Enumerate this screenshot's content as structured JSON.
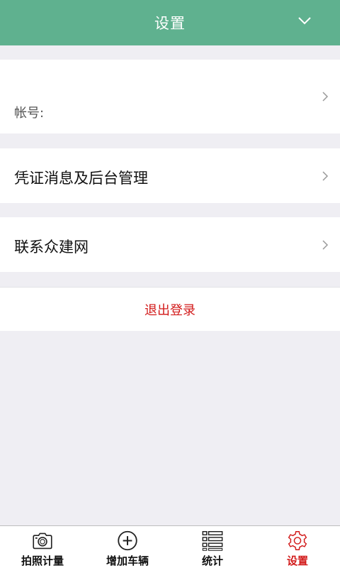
{
  "header": {
    "title": "设置",
    "dropdown_icon": "chevron-down-icon",
    "background_color": "#5fb18f"
  },
  "settings": {
    "account_label": "帐号:",
    "voucher_label": "凭证消息及后台管理",
    "contact_label": "联系众建网",
    "arrow_icon": "chevron-right-icon"
  },
  "logout": {
    "label": "退出登录",
    "color": "#d21a1a"
  },
  "tabbar": {
    "tabs": [
      {
        "label": "拍照计量",
        "icon": "camera-icon",
        "active": false
      },
      {
        "label": "增加车辆",
        "icon": "add-circle-icon",
        "active": false
      },
      {
        "label": "统计",
        "icon": "list-icon",
        "active": false
      },
      {
        "label": "设置",
        "icon": "gear-icon",
        "active": true
      }
    ],
    "active_color": "#d21a1a"
  }
}
